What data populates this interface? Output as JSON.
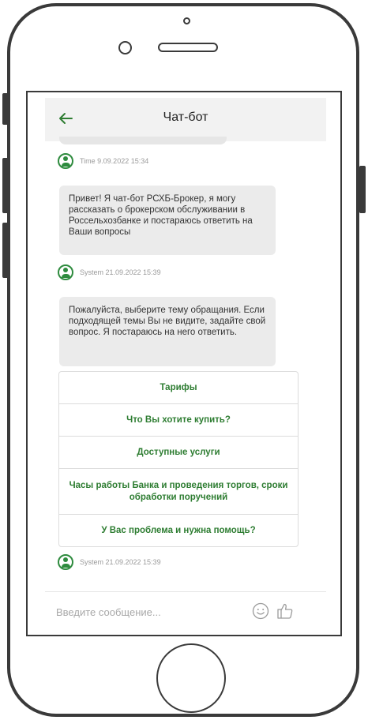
{
  "header": {
    "title": "Чат-бот"
  },
  "messages": [
    {
      "author": "Time 9.09.2022 15:34"
    },
    {
      "text": "Привет! Я чат-бот РСХБ-Брокер, я могу рассказать о брокерском обслуживании в Россельхозбанке и постараюсь ответить на Ваши вопросы",
      "author": "System 21.09.2022 15:39"
    },
    {
      "text": "Пожалуйста, выберите тему обращания. Если подходящей темы Вы не видите, задайте свой вопрос. Я постараюсь на него ответить.",
      "author": "System 21.09.2022 15:39"
    }
  ],
  "quick_replies": [
    "Тарифы",
    "Что Вы хотите купить?",
    "Доступные услуги",
    "Часы работы Банка и проведения торгов, сроки обработки поручений",
    "У Вас проблема и нужна помощь?"
  ],
  "composer": {
    "placeholder": "Введите сообщение...",
    "value": ""
  },
  "icons": [
    "back-arrow-icon",
    "user-avatar-icon",
    "emoji-icon",
    "thumbs-up-icon"
  ],
  "colors": {
    "accent": "#2e7d32",
    "bubble": "#ebebeb",
    "frame": "#3a3a3a"
  }
}
